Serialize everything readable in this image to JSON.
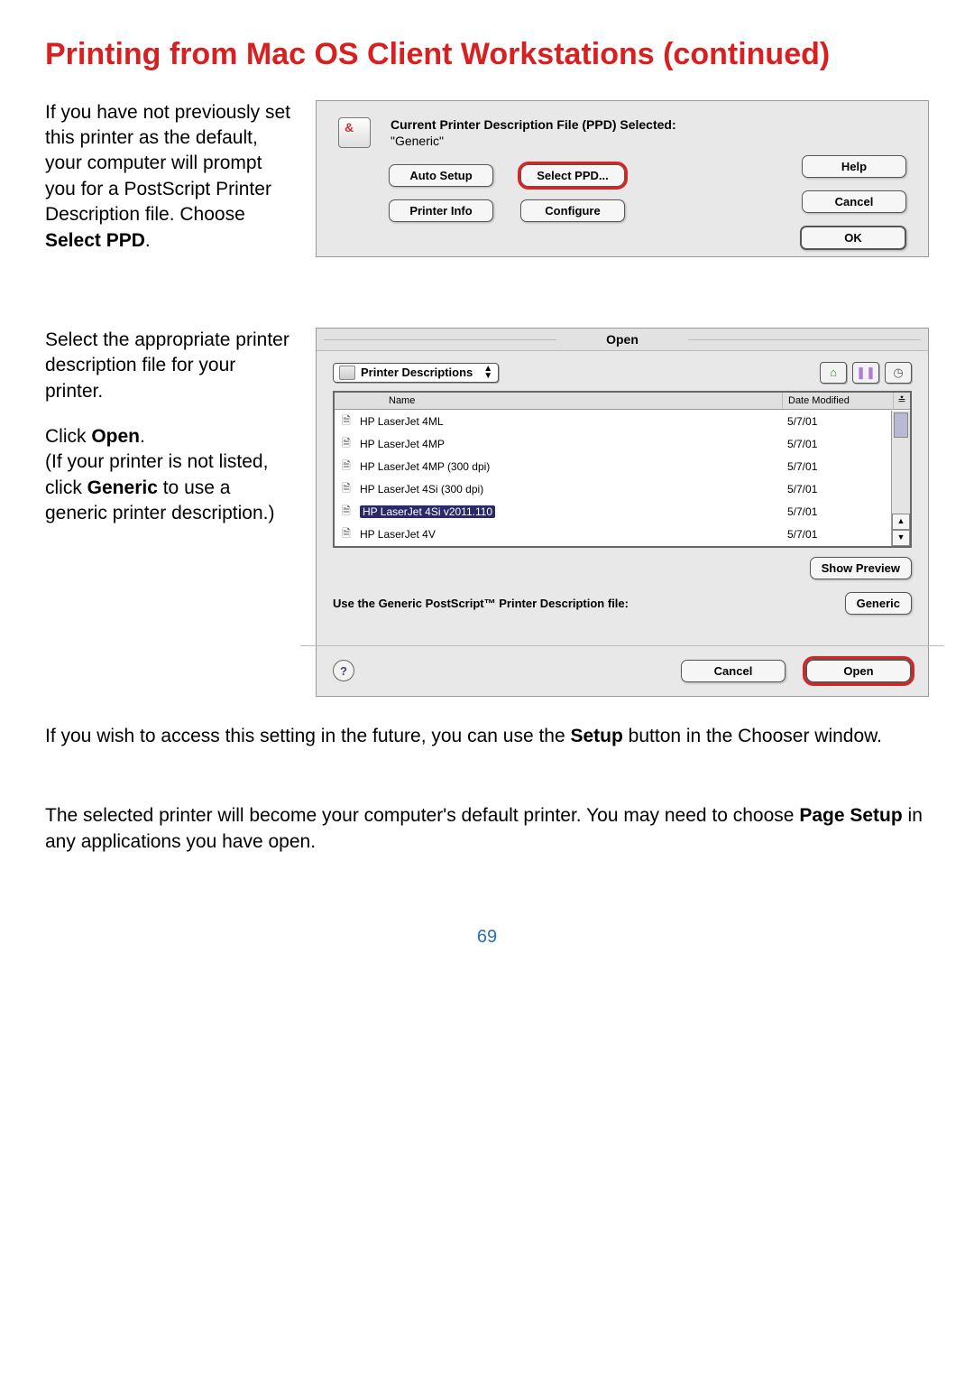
{
  "title": "Printing from Mac OS Client Workstations (continued)",
  "instr1": {
    "pre": "If you have not previously set this printer as the default, your computer will prompt you for a PostScript Printer Description file. Choose ",
    "bold": "Select PPD",
    "post": "."
  },
  "ppd": {
    "header": "Current Printer Description File (PPD) Selected:",
    "current": "\"Generic\"",
    "auto_setup": "Auto Setup",
    "select_ppd": "Select PPD...",
    "printer_info": "Printer Info",
    "configure": "Configure",
    "help": "Help",
    "cancel": "Cancel",
    "ok": "OK"
  },
  "instr2": {
    "p1": "Select the appropriate printer description file for your printer.",
    "p2_pre": "Click ",
    "p2_bold": "Open",
    "p2_post": ".",
    "p3_pre": "(If your printer is not listed, click ",
    "p3_bold": "Generic",
    "p3_post": " to use a generic printer description.)"
  },
  "open": {
    "title": "Open",
    "folder": "Printer Descriptions",
    "col_name": "Name",
    "col_date": "Date Modified",
    "rows": [
      {
        "name": "HP LaserJet 4ML",
        "date": "5/7/01",
        "sel": false
      },
      {
        "name": "HP LaserJet 4MP",
        "date": "5/7/01",
        "sel": false
      },
      {
        "name": "HP LaserJet 4MP (300 dpi)",
        "date": "5/7/01",
        "sel": false
      },
      {
        "name": "HP LaserJet 4Si (300 dpi)",
        "date": "5/7/01",
        "sel": false
      },
      {
        "name": "HP LaserJet 4Si v2011.110",
        "date": "5/7/01",
        "sel": true
      },
      {
        "name": "HP LaserJet 4V",
        "date": "5/7/01",
        "sel": false
      }
    ],
    "show_preview": "Show Preview",
    "generic_label": "Use the Generic PostScript™ Printer Description file:",
    "generic_btn": "Generic",
    "cancel": "Cancel",
    "open_btn": "Open"
  },
  "para_future_pre": "If you wish to access this setting in the future, you can use the ",
  "para_future_bold": "Setup",
  "para_future_post": " button in the Chooser window.",
  "para_default_pre": "The selected printer will become your computer's default printer. You may need to choose ",
  "para_default_bold": "Page Setup",
  "para_default_post": " in any applications you have open.",
  "page_number": "69"
}
